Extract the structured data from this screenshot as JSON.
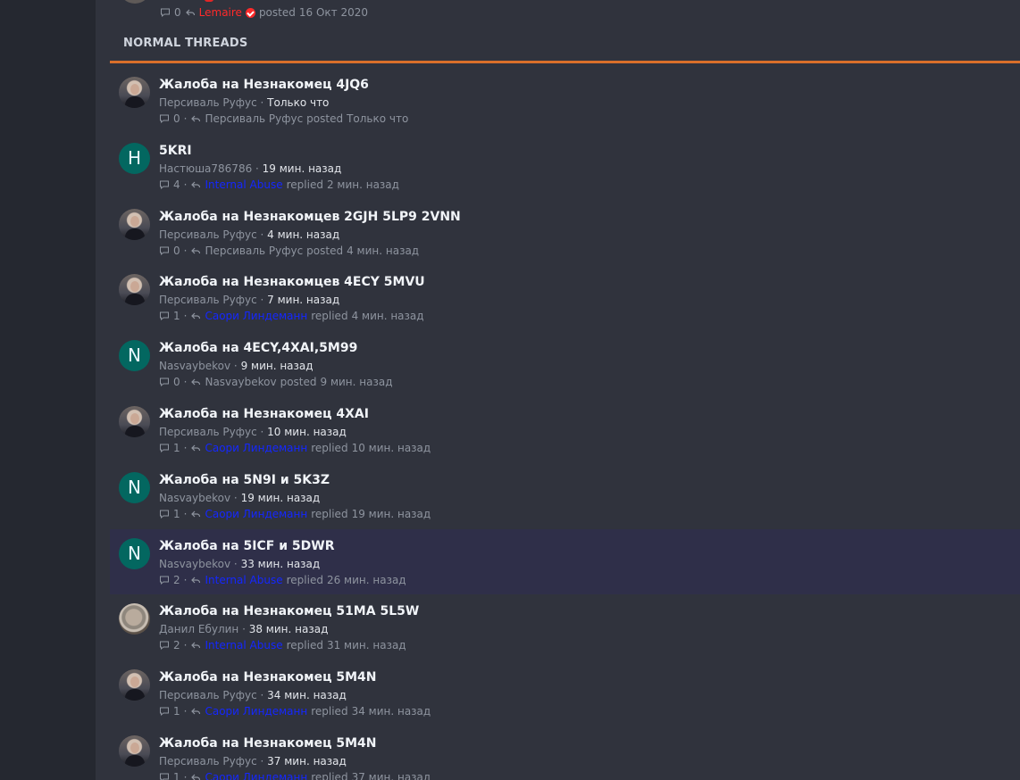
{
  "previous_thread": {
    "meta": {
      "count": "0",
      "author": "Lemaire",
      "action": "posted",
      "time": "16 Окт 2020"
    }
  },
  "section_title": "NORMAL THREADS",
  "threads": [
    {
      "title": "Жалоба на Незнакомец 4JQ6",
      "author": "Персиваль Руфус",
      "time": "Только что",
      "count": "0",
      "last_user": "Персиваль Руфус",
      "action": "posted",
      "last_time": "Только что",
      "avatar": "photo-a",
      "last_user_style": "plain",
      "highlight": false
    },
    {
      "title": "5KRI",
      "author": "Настюша786786",
      "time": "19 мин. назад",
      "count": "4",
      "last_user": "Internal Abuse",
      "action": "replied",
      "last_time": "2 мин. назад",
      "avatar": "letter",
      "avatar_letter": "H",
      "last_user_style": "blue",
      "highlight": false
    },
    {
      "title": "Жалоба на Незнакомцев 2GJH 5LP9 2VNN",
      "author": "Персиваль Руфус",
      "time": "4 мин. назад",
      "count": "0",
      "last_user": "Персиваль Руфус",
      "action": "posted",
      "last_time": "4 мин. назад",
      "avatar": "photo-a",
      "last_user_style": "plain",
      "highlight": false
    },
    {
      "title": "Жалоба на Незнакомцев 4ECY 5MVU",
      "author": "Персиваль Руфус",
      "time": "7 мин. назад",
      "count": "1",
      "last_user": "Саори Линдеманн",
      "action": "replied",
      "last_time": "4 мин. назад",
      "avatar": "photo-a",
      "last_user_style": "blue",
      "highlight": false
    },
    {
      "title": "Жалоба на 4ECY,4XAI,5M99",
      "author": "Nasvaybekov",
      "time": "9 мин. назад",
      "count": "0",
      "last_user": "Nasvaybekov",
      "action": "posted",
      "last_time": "9 мин. назад",
      "avatar": "letter",
      "avatar_letter": "N",
      "last_user_style": "plain",
      "highlight": false
    },
    {
      "title": "Жалоба на Незнакомец 4XAI",
      "author": "Персиваль Руфус",
      "time": "10 мин. назад",
      "count": "1",
      "last_user": "Саори Линдеманн",
      "action": "replied",
      "last_time": "10 мин. назад",
      "avatar": "photo-a",
      "last_user_style": "blue",
      "highlight": false
    },
    {
      "title": "Жалоба на 5N9I и 5K3Z",
      "author": "Nasvaybekov",
      "time": "19 мин. назад",
      "count": "1",
      "last_user": "Саори Линдеманн",
      "action": "replied",
      "last_time": "19 мин. назад",
      "avatar": "letter",
      "avatar_letter": "N",
      "last_user_style": "blue",
      "highlight": false
    },
    {
      "title": "Жалоба на 5ICF и 5DWR",
      "author": "Nasvaybekov",
      "time": "33 мин. назад",
      "count": "2",
      "last_user": "Internal Abuse",
      "action": "replied",
      "last_time": "26 мин. назад",
      "avatar": "letter",
      "avatar_letter": "N",
      "last_user_style": "blue",
      "highlight": true
    },
    {
      "title": "Жалоба на Незнакомец 51MA 5L5W",
      "author": "Данил Ебулин",
      "time": "38 мин. назад",
      "count": "2",
      "last_user": "Internal Abuse",
      "action": "replied",
      "last_time": "31 мин. назад",
      "avatar": "photo-b",
      "last_user_style": "blue",
      "highlight": false
    },
    {
      "title": "Жалоба на Незнакомец 5M4N",
      "author": "Персиваль Руфус",
      "time": "34 мин. назад",
      "count": "1",
      "last_user": "Саори Линдеманн",
      "action": "replied",
      "last_time": "34 мин. назад",
      "avatar": "photo-a",
      "last_user_style": "blue",
      "highlight": false
    },
    {
      "title": "Жалоба на Незнакомец 5M4N",
      "author": "Персиваль Руфус",
      "time": "37 мин. назад",
      "count": "1",
      "last_user": "Саори Линдеманн",
      "action": "replied",
      "last_time": "37 мин. назад",
      "avatar": "photo-a",
      "last_user_style": "blue",
      "highlight": false
    }
  ]
}
